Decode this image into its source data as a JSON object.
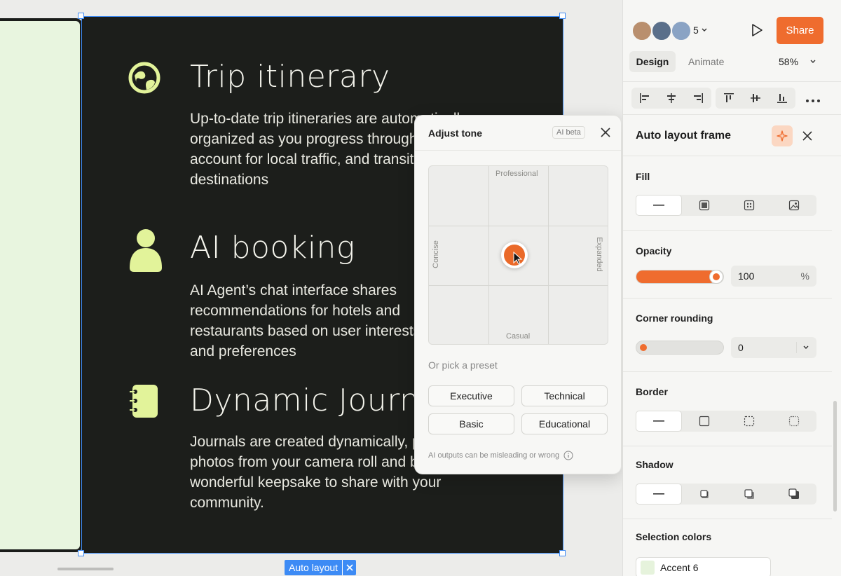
{
  "canvas": {
    "features": [
      {
        "icon": "globe-icon",
        "title": "Trip itinerary",
        "description": "Up-to-date trip itineraries are automatically organized as you progress through your trip to account for local traffic, and transit to destinations"
      },
      {
        "icon": "person-icon",
        "title": "AI booking",
        "description": "AI Agent’s chat interface shares recommendations for hotels and restaurants based on user interests and preferences"
      },
      {
        "icon": "journal-icon",
        "title": "Dynamic Journal",
        "description": "Journals are created dynamically, pulling in photos from your camera roll and building out a wonderful keepsake to share with your community."
      }
    ],
    "badge": {
      "label": "Auto layout"
    }
  },
  "tone_popup": {
    "title": "Adjust tone",
    "beta_badge": "AI beta",
    "axes": {
      "top": "Professional",
      "bottom": "Casual",
      "left": "Concise",
      "right": "Expanded"
    },
    "preset_label": "Or pick a preset",
    "presets": [
      "Executive",
      "Technical",
      "Basic",
      "Educational"
    ],
    "warning": "AI outputs can be misleading or wrong"
  },
  "panel": {
    "collaborator_count": "5",
    "share_label": "Share",
    "tabs": {
      "design": "Design",
      "animate": "Animate"
    },
    "zoom": "58%",
    "header_title": "Auto layout frame",
    "sections": {
      "fill": "Fill",
      "opacity": "Opacity",
      "corner": "Corner rounding",
      "border": "Border",
      "shadow": "Shadow",
      "selection_colors": "Selection colors"
    },
    "opacity": {
      "value": "100",
      "suffix": "%",
      "fraction": 1.0
    },
    "corner": {
      "value": "0",
      "fraction": 0.0
    },
    "selection_color": {
      "name": "Accent 6",
      "hex": "#e6f3dc"
    }
  },
  "colors": {
    "accent": "#ef6c2e",
    "frame_dark": "#1c1e1b",
    "icon_lime": "#e2f39a",
    "selection_blue": "#3d8bf5"
  }
}
